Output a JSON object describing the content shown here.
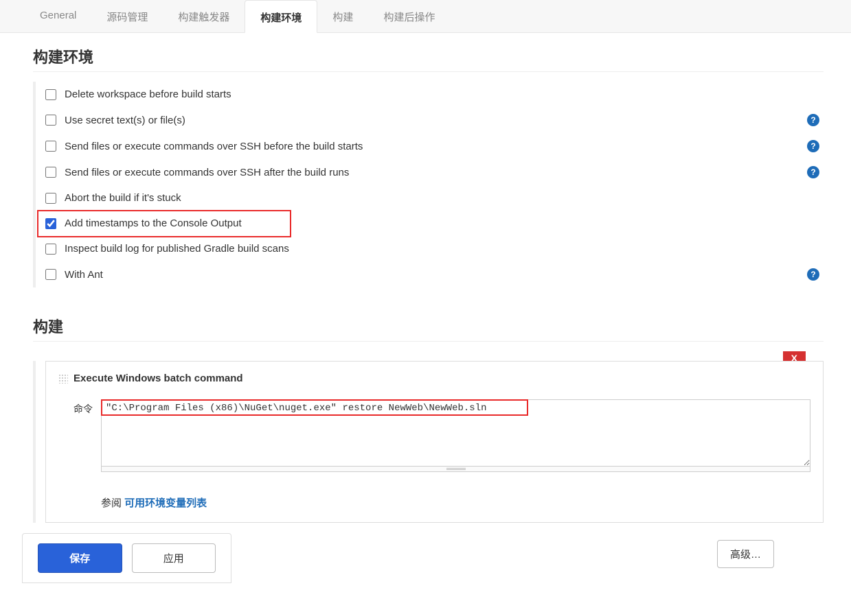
{
  "tabs": {
    "items": [
      {
        "label": "General",
        "active": false
      },
      {
        "label": "源码管理",
        "active": false
      },
      {
        "label": "构建触发器",
        "active": false
      },
      {
        "label": "构建环境",
        "active": true
      },
      {
        "label": "构建",
        "active": false
      },
      {
        "label": "构建后操作",
        "active": false
      }
    ]
  },
  "sections": {
    "env_title": "构建环境",
    "build_title": "构建"
  },
  "env_options": [
    {
      "label": "Delete workspace before build starts",
      "checked": false,
      "help": false
    },
    {
      "label": "Use secret text(s) or file(s)",
      "checked": false,
      "help": true
    },
    {
      "label": "Send files or execute commands over SSH before the build starts",
      "checked": false,
      "help": true
    },
    {
      "label": "Send files or execute commands over SSH after the build runs",
      "checked": false,
      "help": true
    },
    {
      "label": "Abort the build if it's stuck",
      "checked": false,
      "help": false
    },
    {
      "label": "Add timestamps to the Console Output",
      "checked": true,
      "help": false,
      "highlight": true
    },
    {
      "label": "Inspect build log for published Gradle build scans",
      "checked": false,
      "help": false
    },
    {
      "label": "With Ant",
      "checked": false,
      "help": true
    }
  ],
  "build_step": {
    "title": "Execute Windows batch command",
    "delete_label": "X",
    "cmd_label": "命令",
    "cmd_value": "\"C:\\Program Files (x86)\\NuGet\\nuget.exe\" restore NewWeb\\NewWeb.sln",
    "ref_prefix": "参阅 ",
    "ref_link": "可用环境变量列表"
  },
  "footer": {
    "save": "保存",
    "apply": "应用",
    "advanced": "高级…"
  },
  "help_glyph": "?"
}
